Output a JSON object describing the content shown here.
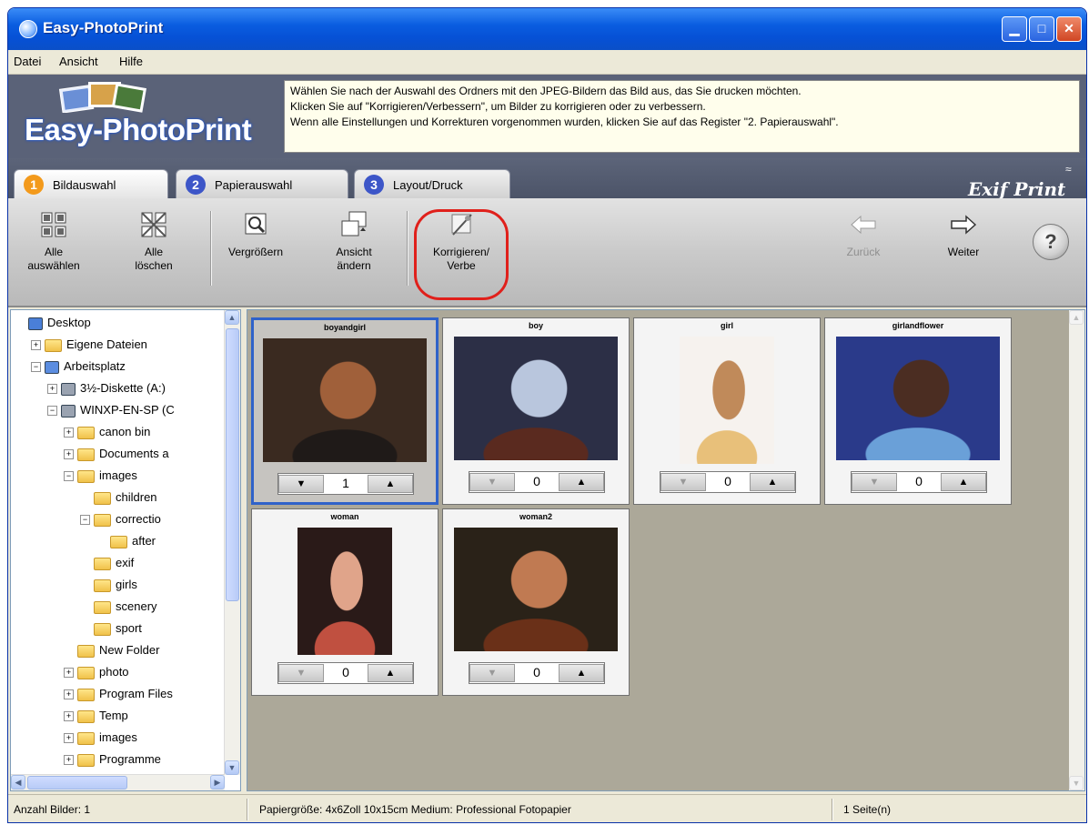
{
  "window": {
    "title": "Easy-PhotoPrint"
  },
  "menu": [
    "Datei",
    "Ansicht",
    "Hilfe"
  ],
  "banner": {
    "logo": "Easy-PhotoPrint",
    "info_lines": [
      "Wählen Sie nach der Auswahl des Ordners mit den JPEG-Bildern das Bild aus, das Sie drucken möchten.",
      "Klicken Sie auf \"Korrigieren/Verbessern\", um Bilder zu korrigieren oder zu verbessern.",
      "Wenn alle Einstellungen und Korrekturen vorgenommen wurden, klicken Sie auf das Register \"2. Papierauswahl\"."
    ]
  },
  "tabs": [
    {
      "num": "1",
      "label": "Bildauswahl"
    },
    {
      "num": "2",
      "label": "Papierauswahl"
    },
    {
      "num": "3",
      "label": "Layout/Druck"
    }
  ],
  "brand": {
    "exif": "Exif Print"
  },
  "toolbar": {
    "select_all": [
      "Alle",
      "auswählen"
    ],
    "clear_all": [
      "Alle",
      "löschen"
    ],
    "zoom": [
      "Vergrößern"
    ],
    "change_view": [
      "Ansicht",
      "ändern"
    ],
    "correct": [
      "Korrigieren/",
      "Verbe"
    ],
    "back": "Zurück",
    "next": "Weiter",
    "help": "?"
  },
  "tree": [
    {
      "label": "Desktop",
      "level": 0,
      "exp": "",
      "icon": "desktop"
    },
    {
      "label": "Eigene Dateien",
      "level": 1,
      "exp": "+",
      "icon": "folder"
    },
    {
      "label": "Arbeitsplatz",
      "level": 1,
      "exp": "−",
      "icon": "computer"
    },
    {
      "label": "3½-Diskette (A:)",
      "level": 2,
      "exp": "+",
      "icon": "drive"
    },
    {
      "label": "WINXP-EN-SP (C",
      "level": 2,
      "exp": "−",
      "icon": "drive"
    },
    {
      "label": "canon bin",
      "level": 3,
      "exp": "+",
      "icon": "folder"
    },
    {
      "label": "Documents a",
      "level": 3,
      "exp": "+",
      "icon": "folder"
    },
    {
      "label": "images",
      "level": 3,
      "exp": "−",
      "icon": "folder"
    },
    {
      "label": "children",
      "level": 4,
      "exp": "",
      "icon": "folder"
    },
    {
      "label": "correctio",
      "level": 4,
      "exp": "−",
      "icon": "folder"
    },
    {
      "label": "after",
      "level": 5,
      "exp": "",
      "icon": "folder"
    },
    {
      "label": "exif",
      "level": 4,
      "exp": "",
      "icon": "folder"
    },
    {
      "label": "girls",
      "level": 4,
      "exp": "",
      "icon": "folder"
    },
    {
      "label": "scenery",
      "level": 4,
      "exp": "",
      "icon": "folder"
    },
    {
      "label": "sport",
      "level": 4,
      "exp": "",
      "icon": "folder"
    },
    {
      "label": "New Folder",
      "level": 3,
      "exp": "",
      "icon": "folder"
    },
    {
      "label": "photo",
      "level": 3,
      "exp": "+",
      "icon": "folder"
    },
    {
      "label": "Program Files",
      "level": 3,
      "exp": "+",
      "icon": "folder"
    },
    {
      "label": "Temp",
      "level": 3,
      "exp": "+",
      "icon": "folder"
    },
    {
      "label": "images",
      "level": 3,
      "exp": "+",
      "icon": "folder"
    },
    {
      "label": "Programme",
      "level": 3,
      "exp": "+",
      "icon": "folder"
    }
  ],
  "photos": [
    {
      "name": "boyandgirl",
      "count": "1",
      "selected": true,
      "colors": [
        "#3a2a20",
        "#a0603a",
        "#1f1a18"
      ]
    },
    {
      "name": "boy",
      "count": "0",
      "selected": false,
      "colors": [
        "#2c2f46",
        "#b9c6dd",
        "#5a2a1f"
      ]
    },
    {
      "name": "girl",
      "count": "0",
      "selected": false,
      "colors": [
        "#f6f2ee",
        "#c08a5a",
        "#e8c07a"
      ]
    },
    {
      "name": "girlandflower",
      "count": "0",
      "selected": false,
      "colors": [
        "#2a3a8a",
        "#4b2d22",
        "#6aa0d8"
      ]
    },
    {
      "name": "woman",
      "count": "0",
      "selected": false,
      "colors": [
        "#2a1a18",
        "#e0a48a",
        "#c05040"
      ]
    },
    {
      "name": "woman2",
      "count": "0",
      "selected": false,
      "colors": [
        "#2a2218",
        "#c07a52",
        "#6a3018"
      ]
    }
  ],
  "status": {
    "count": "Anzahl Bilder: 1",
    "paper": "Papiergröße: 4x6Zoll 10x15cm  Medium: Professional Fotopapier",
    "pages": "1 Seite(n)"
  },
  "colors": {
    "accent": "#0a5de0",
    "highlight": "#e0201b",
    "tab1": "#f39a1c",
    "tab23": "#3d56c8"
  }
}
